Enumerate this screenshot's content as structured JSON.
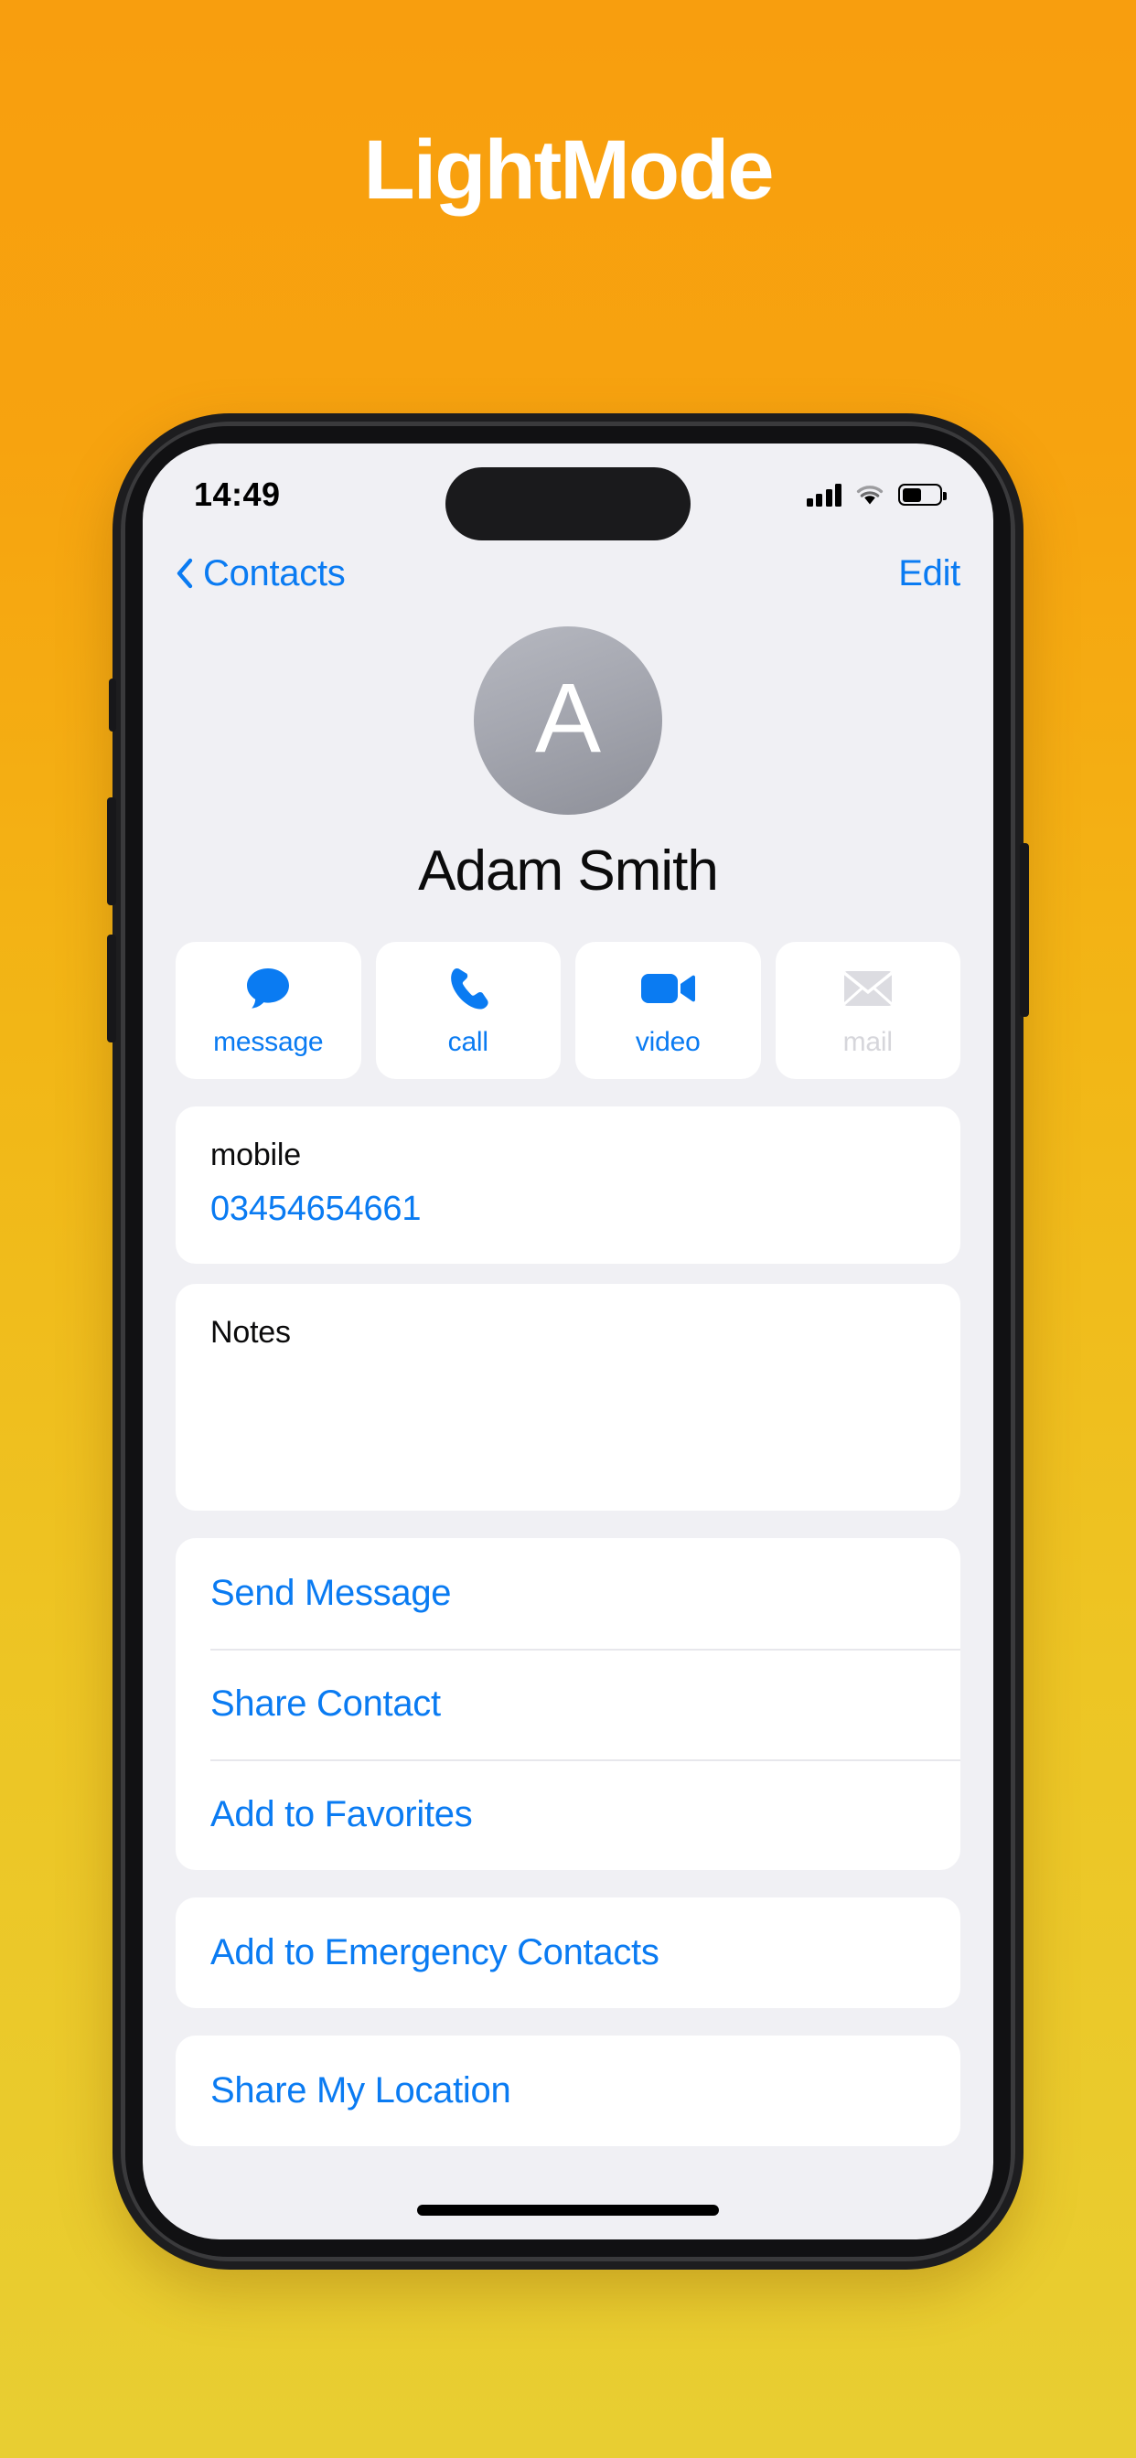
{
  "page": {
    "title": "LightMode",
    "background_top_color": "#F89E0E",
    "background_bottom_color": "#E8CE32",
    "accent_color": "#0A7BF2"
  },
  "status_bar": {
    "time": "14:49",
    "signal_icon": "cellular-signal-icon",
    "wifi_icon": "wifi-icon",
    "battery_icon": "battery-icon",
    "battery_level_percent": 52
  },
  "nav_bar": {
    "back_icon": "chevron-left-icon",
    "back_label": "Contacts",
    "edit_label": "Edit"
  },
  "contact": {
    "avatar_initial": "A",
    "name": "Adam Smith"
  },
  "actions": [
    {
      "label": "message",
      "icon": "message-bubble-icon",
      "enabled": true
    },
    {
      "label": "call",
      "icon": "phone-icon",
      "enabled": true
    },
    {
      "label": "video",
      "icon": "video-camera-icon",
      "enabled": true
    },
    {
      "label": "mail",
      "icon": "envelope-icon",
      "enabled": false
    }
  ],
  "phone_field": {
    "label": "mobile",
    "value": "03454654661"
  },
  "notes": {
    "label": "Notes",
    "value": ""
  },
  "options_group_1": [
    {
      "label": "Send Message"
    },
    {
      "label": "Share Contact"
    },
    {
      "label": "Add to Favorites"
    }
  ],
  "options_group_2": [
    {
      "label": "Add to Emergency Contacts"
    }
  ],
  "options_group_3": [
    {
      "label": "Share My Location"
    }
  ],
  "home_indicator": "home-indicator"
}
